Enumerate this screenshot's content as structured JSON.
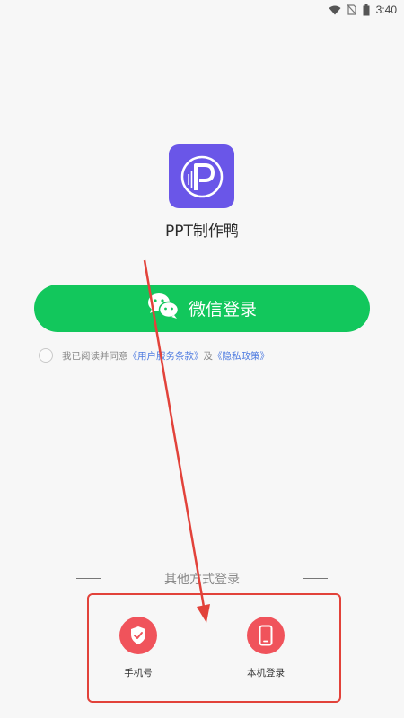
{
  "status_bar": {
    "time": "3:40",
    "icons": [
      "wifi-icon",
      "no-sim-icon",
      "battery-icon"
    ]
  },
  "app": {
    "name": "PPT制作鸭",
    "logo_icon": "ppt-duck-logo-icon",
    "logo_color": "#6a56e8"
  },
  "wechat_login": {
    "label": "微信登录",
    "icon": "wechat-icon",
    "color": "#12c75c"
  },
  "agreement": {
    "prefix": "我已阅读并同意",
    "terms_link": "《用户服务条款》",
    "joiner": "及",
    "privacy_link": "《隐私政策》",
    "checked": false
  },
  "other_login": {
    "title": "其他方式登录",
    "options": [
      {
        "label": "手机号",
        "icon": "shield-check-icon"
      },
      {
        "label": "本机登录",
        "icon": "mobile-phone-icon"
      }
    ],
    "accent_color": "#f0535b"
  },
  "annotation": {
    "color": "#e2423a"
  }
}
